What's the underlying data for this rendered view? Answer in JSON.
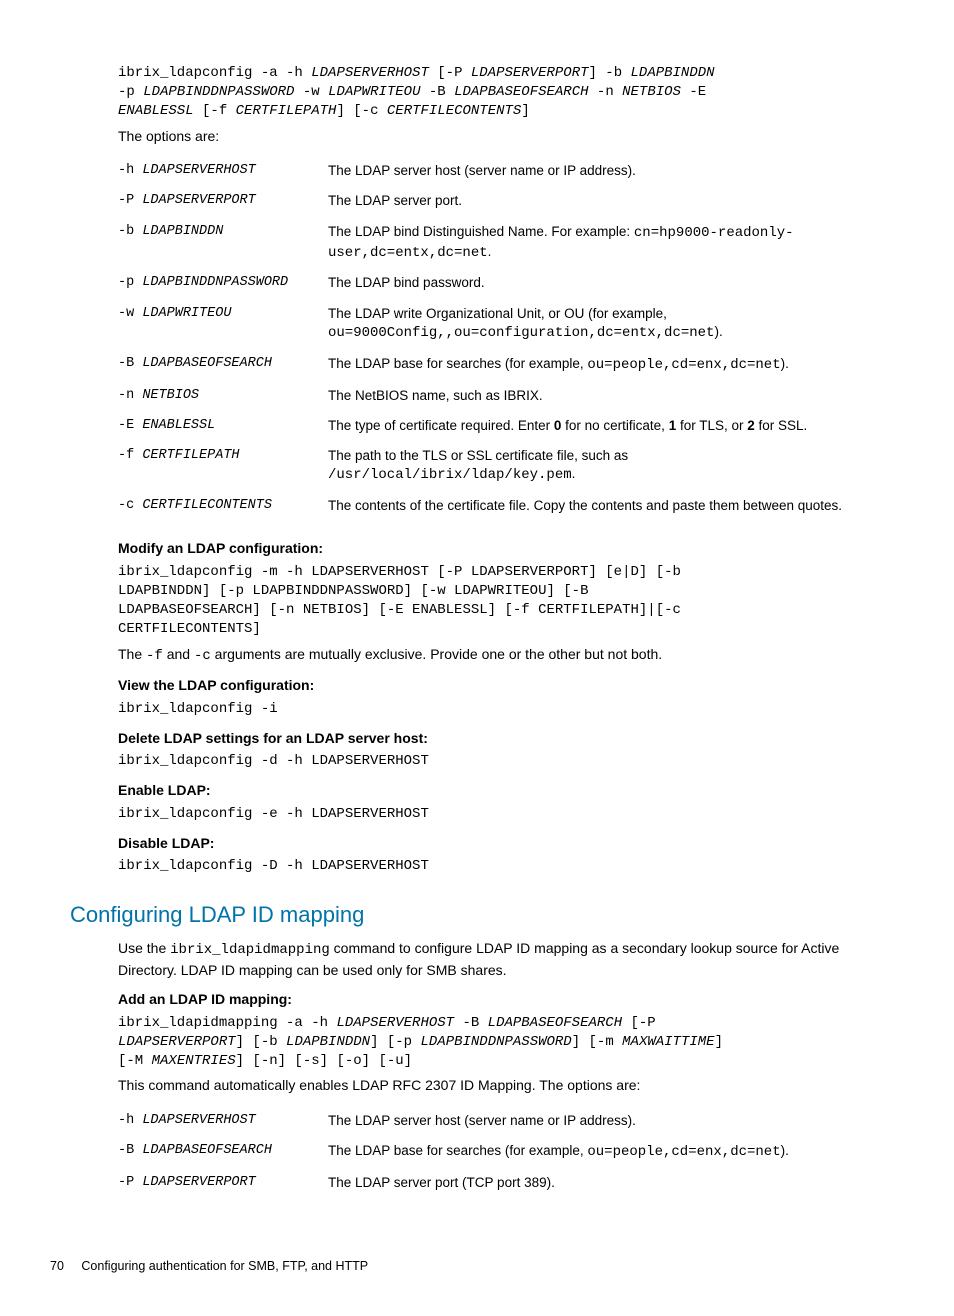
{
  "syntax1_html": "ibrix_ldapconfig -a -h <span class='italic'>LDAPSERVERHOST</span> [-P <span class='italic'>LDAPSERVERPORT</span>] -b <span class='italic'>LDAPBINDDN</span>\n-p <span class='italic'>LDAPBINDDNPASSWORD</span> -w <span class='italic'>LDAPWRITEOU</span> -B <span class='italic'>LDAPBASEOFSEARCH</span> -n <span class='italic'>NETBIOS</span> -E\n<span class='italic'>ENABLESSL</span> [-f <span class='italic'>CERTFILEPATH</span>] [-c <span class='italic'>CERTFILECONTENTS</span>]",
  "options_intro": "The options are:",
  "table1": [
    {
      "flag": "-h",
      "arg": "LDAPSERVERHOST",
      "desc": "The LDAP server host (server name or IP address)."
    },
    {
      "flag": "-P",
      "arg": "LDAPSERVERPORT",
      "desc": "The LDAP server port."
    },
    {
      "flag": "-b",
      "arg": "LDAPBINDDN",
      "desc": "The LDAP bind Distinguished Name. For example: <span class='mono'>cn=hp9000-readonly-user,dc=entx,dc=net</span>."
    },
    {
      "flag": "-p",
      "arg": "LDAPBINDDNPASSWORD",
      "desc": "The LDAP bind password."
    },
    {
      "flag": "-w",
      "arg": "LDAPWRITEOU",
      "desc": "The LDAP write Organizational Unit, or OU (for example, <span class='mono'>ou=9000Config,,ou=configuration,dc=entx,dc=net</span>)."
    },
    {
      "flag": "-B",
      "arg": "LDAPBASEOFSEARCH",
      "desc": "The LDAP base for searches (for example, <span class='mono'>ou=people,cd=enx,dc=net</span>)."
    },
    {
      "flag": "-n",
      "arg": "NETBIOS",
      "desc": "The NetBIOS name, such as IBRIX."
    },
    {
      "flag": "-E",
      "arg": "ENABLESSL",
      "desc": "The type of certificate required. Enter <b>0</b> for no certificate, <b>1</b> for TLS, or <b>2</b> for SSL."
    },
    {
      "flag": "-f",
      "arg": "CERTFILEPATH",
      "desc": "The path to the TLS or SSL certificate file, such as <span class='mono'>/usr/local/ibrix/ldap/key.pem</span>."
    },
    {
      "flag": "-c",
      "arg": "CERTFILECONTENTS",
      "desc": "The contents of the certificate file. Copy the contents and paste them between quotes."
    }
  ],
  "modify_label": "Modify an LDAP configuration:",
  "modify_cmd": "ibrix_ldapconfig -m -h LDAPSERVERHOST [-P LDAPSERVERPORT] [e|D] [-b\nLDAPBINDDN] [-p LDAPBINDDNPASSWORD] [-w LDAPWRITEOU] [-B\nLDAPBASEOFSEARCH] [-n NETBIOS] [-E ENABLESSL] [-f CERTFILEPATH]|[-c\nCERTFILECONTENTS]",
  "modify_note_html": "The <span class='mono'>-f</span> and <span class='mono'>-c</span> arguments are mutually exclusive. Provide one or the other but not both.",
  "view_label": "View the LDAP configuration:",
  "view_cmd": "ibrix_ldapconfig -i",
  "delete_label": "Delete LDAP settings for an LDAP server host:",
  "delete_cmd": "ibrix_ldapconfig -d -h LDAPSERVERHOST",
  "enable_label": "Enable LDAP:",
  "enable_cmd": "ibrix_ldapconfig -e -h LDAPSERVERHOST",
  "disable_label": "Disable LDAP:",
  "disable_cmd": "ibrix_ldapconfig -D -h LDAPSERVERHOST",
  "h2": "Configuring LDAP ID mapping",
  "idmap_intro_html": "Use the <span class='mono'>ibrix_ldapidmapping</span> command to configure LDAP ID mapping as a secondary lookup source for Active Directory. LDAP ID mapping can be used only for SMB shares.",
  "add_label": "Add an LDAP ID mapping:",
  "add_cmd_html": "ibrix_ldapidmapping -a -h <span class='italic'>LDAPSERVERHOST</span> -B <span class='italic'>LDAPBASEOFSEARCH</span> [-P\n<span class='italic'>LDAPSERVERPORT</span>] [-b <span class='italic'>LDAPBINDDN</span>] [-p <span class='italic'>LDAPBINDDNPASSWORD</span>] [-m <span class='italic'>MAXWAITTIME</span>]\n[-M <span class='italic'>MAXENTRIES</span>] [-n] [-s] [-o] [-u]",
  "add_note": "This command automatically enables LDAP RFC 2307 ID Mapping. The options are:",
  "table2": [
    {
      "flag": "-h",
      "arg": "LDAPSERVERHOST",
      "desc": "The LDAP server host (server name or IP address)."
    },
    {
      "flag": "-B",
      "arg": "LDAPBASEOFSEARCH",
      "desc": "The LDAP base for searches (for example, <span class='mono'>ou=people,cd=enx,dc=net</span>)."
    },
    {
      "flag": "-P",
      "arg": "LDAPSERVERPORT",
      "desc": "The LDAP server port (TCP port 389)."
    }
  ],
  "footer_page": "70",
  "footer_text": "Configuring authentication for SMB, FTP, and HTTP"
}
